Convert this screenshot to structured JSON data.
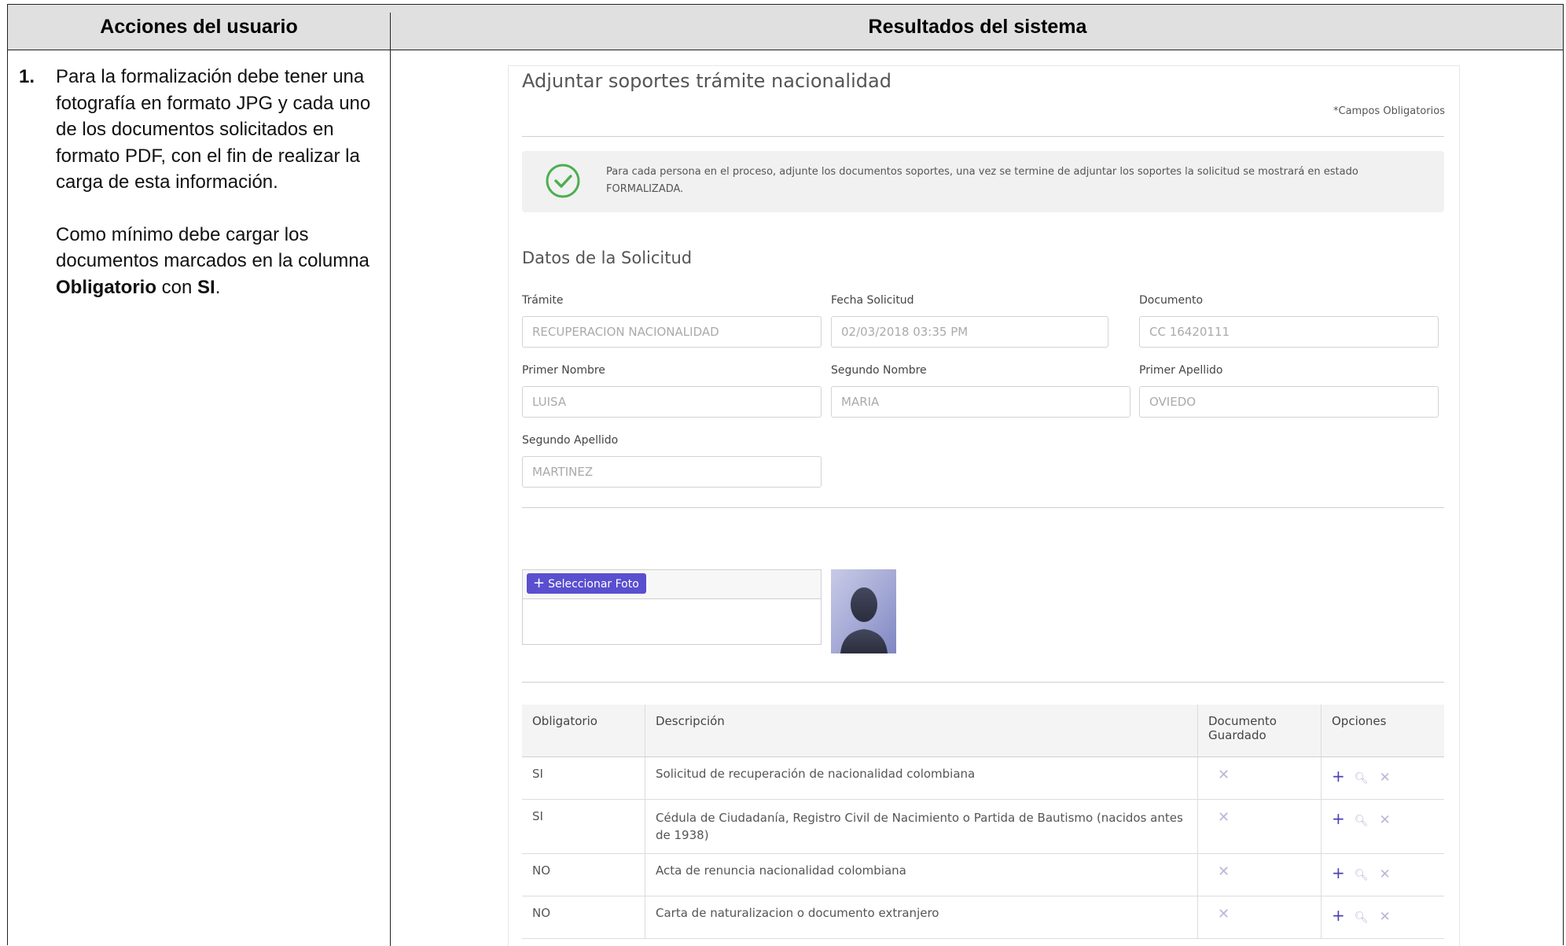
{
  "headers": {
    "left": "Acciones del usuario",
    "right": "Resultados del sistema"
  },
  "step": {
    "number": "1.",
    "para1": "Para la formalización debe tener una fotografía en formato JPG y cada uno de los documentos solicitados en formato PDF, con el fin de realizar la carga de esta información.",
    "para2_pre": "Como mínimo debe cargar los documentos marcados en la columna ",
    "para2_bold1": "Obligatorio",
    "para2_mid": " con ",
    "para2_bold2": "SI",
    "para2_end": "."
  },
  "panel": {
    "title": "Adjuntar soportes trámite nacionalidad",
    "required_note": "*Campos Obligatorios",
    "notice": "Para cada persona en el proceso, adjunte los documentos soportes, una vez se termine de adjuntar los soportes la solicitud se mostrará en estado FORMALIZADA.",
    "section_title": "Datos de la Solicitud",
    "fields": {
      "tramite": {
        "label": "Trámite",
        "value": "RECUPERACION NACIONALIDAD"
      },
      "fecha": {
        "label": "Fecha Solicitud",
        "value": "02/03/2018 03:35 PM"
      },
      "documento": {
        "label": "Documento",
        "value": "CC 16420111"
      },
      "primer_nombre": {
        "label": "Primer Nombre",
        "value": "LUISA"
      },
      "segundo_nombre": {
        "label": "Segundo Nombre",
        "value": "MARIA"
      },
      "primer_apellido": {
        "label": "Primer Apellido",
        "value": "OVIEDO"
      },
      "segundo_apellido": {
        "label": "Segundo Apellido",
        "value": "MARTINEZ"
      }
    },
    "select_photo_label": "Seleccionar Foto",
    "table": {
      "columns": [
        "Obligatorio",
        "Descripción",
        "Documento Guardado",
        "Opciones"
      ],
      "rows": [
        {
          "obligatorio": "SI",
          "descripcion": "Solicitud de recuperación de nacionalidad colombiana"
        },
        {
          "obligatorio": "SI",
          "descripcion": "Cédula de Ciudadanía, Registro Civil de Nacimiento o Partida de Bautismo (nacidos antes de 1938)"
        },
        {
          "obligatorio": "NO",
          "descripcion": "Acta de renuncia nacionalidad colombiana"
        },
        {
          "obligatorio": "NO",
          "descripcion": "Carta de naturalizacion o documento extranjero"
        }
      ]
    },
    "accent_color": "#5a4fcf",
    "success_color": "#4caf50"
  }
}
